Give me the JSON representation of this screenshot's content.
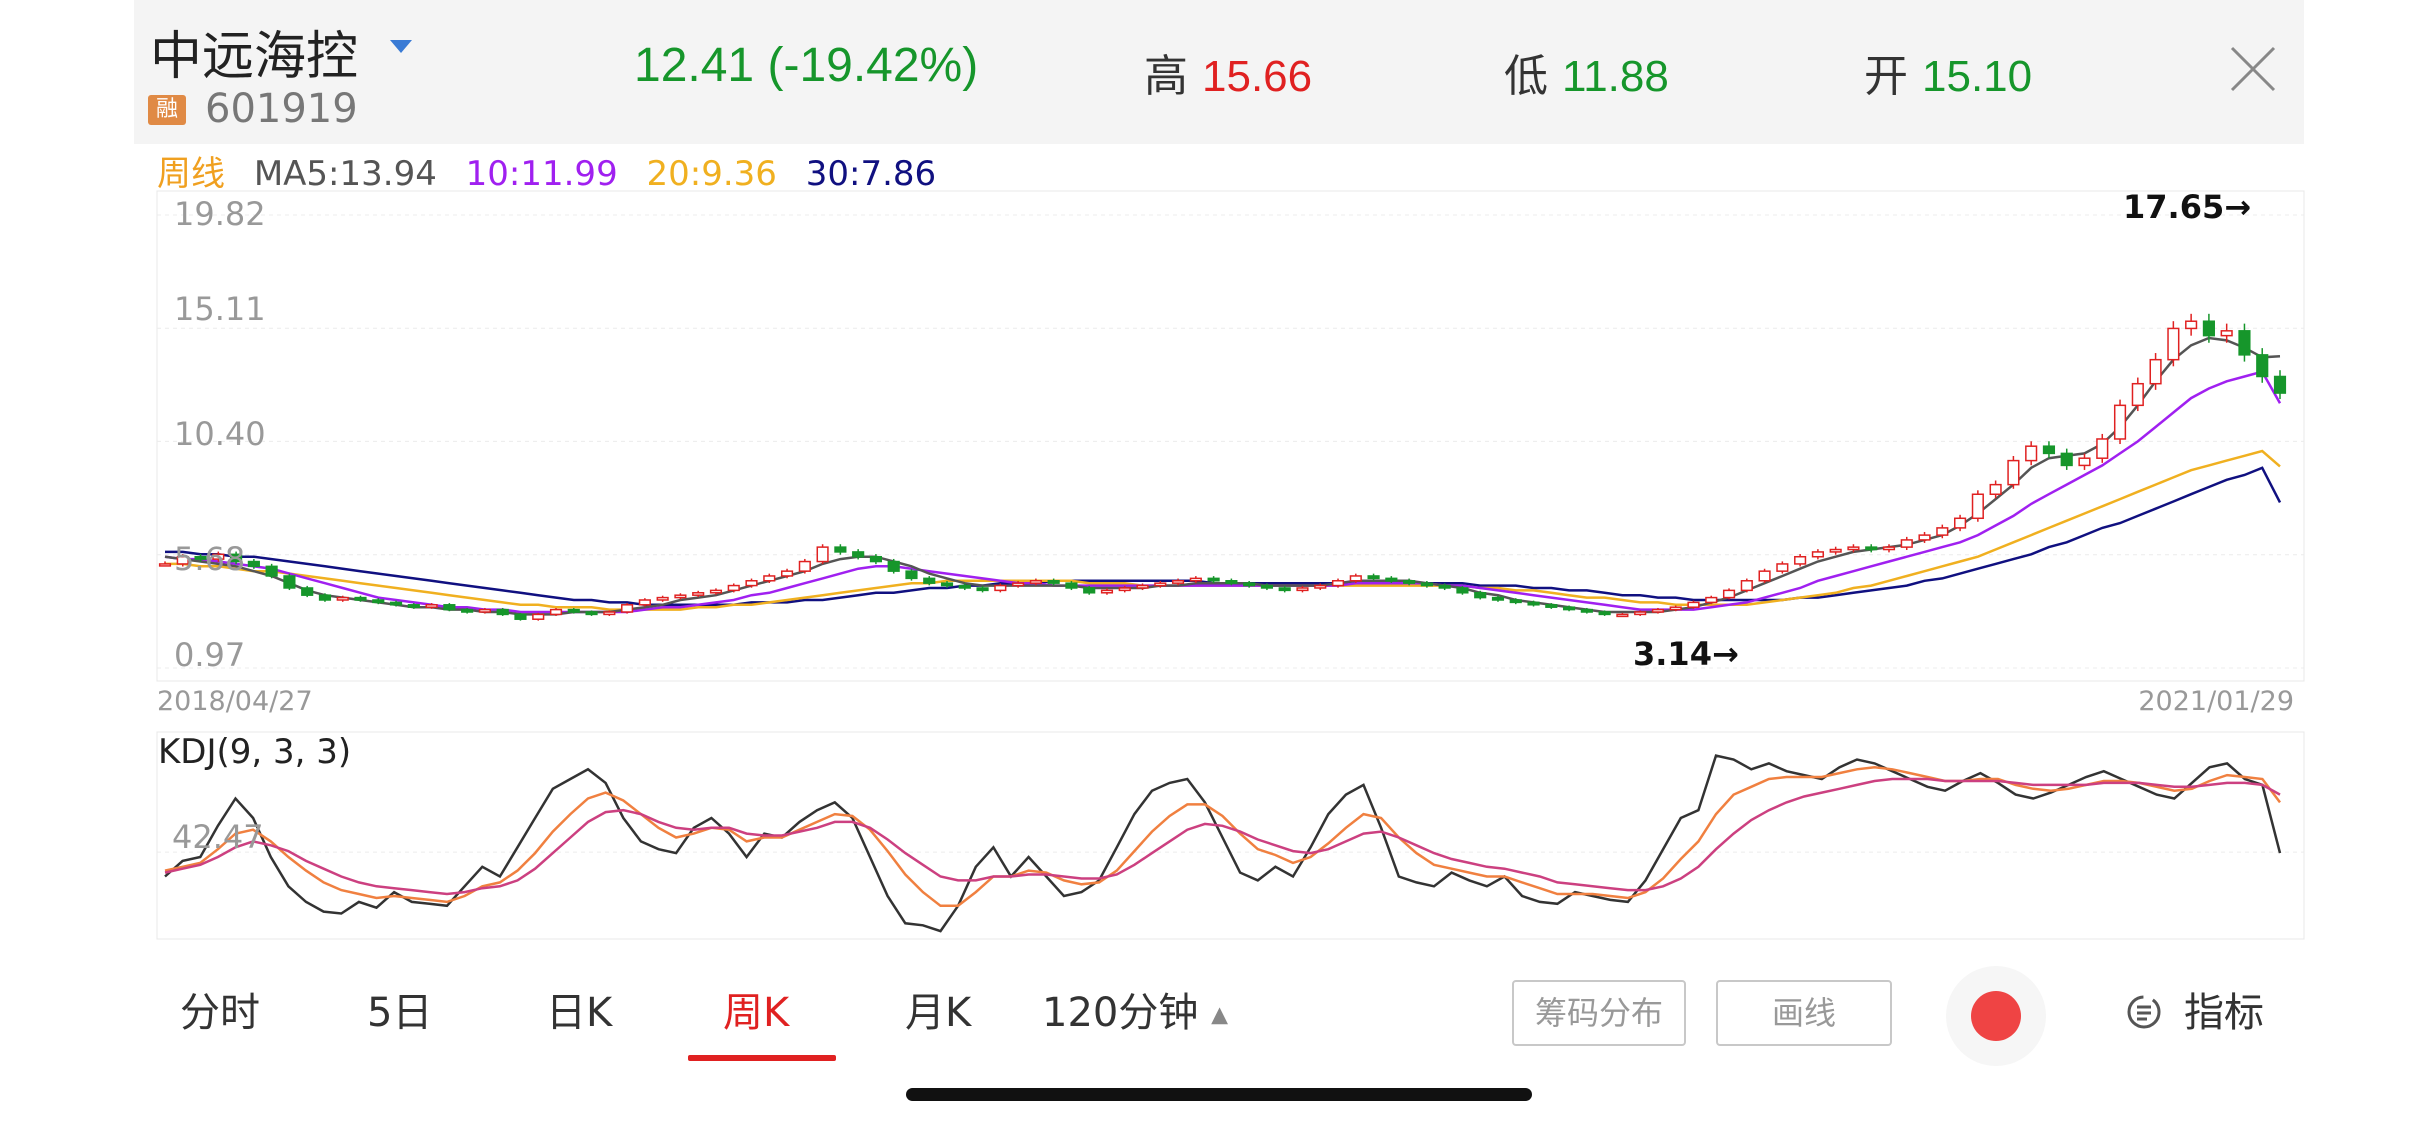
{
  "header": {
    "stock_name": "中远海控",
    "margin_badge": "融",
    "stock_code": "601919",
    "price": "12.41",
    "change_pct": "(-19.42%)",
    "high_label": "高",
    "high_value": "15.66",
    "low_label": "低",
    "low_value": "11.88",
    "open_label": "开",
    "open_value": "15.10"
  },
  "ma_legend": {
    "period": "周线",
    "ma5": "MA5:13.94",
    "ma10": "10:11.99",
    "ma20": "20:9.36",
    "ma30": "30:7.86"
  },
  "colors": {
    "up": "#e02121",
    "down": "#16962b",
    "ma5": "#555555",
    "ma10": "#a020f0",
    "ma20": "#f0b020",
    "ma30": "#101080",
    "k": "#333333",
    "d": "#f08040",
    "j": "#cc4080"
  },
  "chart_data": [
    {
      "type": "candlestick",
      "title": "周线",
      "y_ticks": [
        "19.82",
        "15.11",
        "10.40",
        "5.68",
        "0.97"
      ],
      "ylim": [
        0.97,
        19.82
      ],
      "x_start_label": "2018/04/27",
      "x_end_label": "2021/01/29",
      "annotations": [
        {
          "text": "17.65→",
          "value": 17.65
        },
        {
          "text": "3.14→",
          "value": 3.14
        }
      ],
      "close": [
        5.3,
        5.6,
        5.5,
        5.7,
        5.4,
        5.2,
        4.8,
        4.3,
        4.0,
        3.8,
        3.9,
        3.8,
        3.7,
        3.6,
        3.5,
        3.6,
        3.4,
        3.3,
        3.4,
        3.2,
        3.0,
        3.2,
        3.4,
        3.3,
        3.2,
        3.3,
        3.6,
        3.8,
        3.9,
        4.0,
        4.1,
        4.2,
        4.4,
        4.6,
        4.8,
        5.0,
        5.4,
        6.0,
        5.8,
        5.6,
        5.4,
        5.0,
        4.7,
        4.5,
        4.4,
        4.3,
        4.2,
        4.4,
        4.5,
        4.6,
        4.5,
        4.3,
        4.1,
        4.2,
        4.3,
        4.4,
        4.5,
        4.6,
        4.7,
        4.6,
        4.5,
        4.4,
        4.3,
        4.2,
        4.3,
        4.4,
        4.6,
        4.8,
        4.7,
        4.6,
        4.5,
        4.4,
        4.3,
        4.1,
        3.9,
        3.8,
        3.7,
        3.6,
        3.5,
        3.4,
        3.3,
        3.2,
        3.2,
        3.3,
        3.4,
        3.5,
        3.7,
        3.9,
        4.2,
        4.6,
        5.0,
        5.3,
        5.6,
        5.8,
        5.9,
        6.0,
        5.9,
        6.0,
        6.3,
        6.5,
        6.8,
        7.2,
        8.2,
        8.6,
        9.6,
        10.2,
        9.9,
        9.4,
        9.7,
        10.5,
        11.9,
        12.8,
        13.8,
        15.1,
        15.4,
        14.8,
        15.0,
        14.0,
        13.1,
        12.41
      ],
      "ma": {
        "ma5": [
          5.6,
          5.5,
          5.4,
          5.3,
          5.2,
          5.0,
          4.8,
          4.5,
          4.2,
          4.0,
          3.9,
          3.8,
          3.7,
          3.6,
          3.5,
          3.5,
          3.4,
          3.4,
          3.3,
          3.3,
          3.2,
          3.2,
          3.2,
          3.3,
          3.3,
          3.3,
          3.4,
          3.5,
          3.6,
          3.8,
          3.9,
          4.0,
          4.2,
          4.4,
          4.6,
          4.8,
          5.0,
          5.3,
          5.5,
          5.6,
          5.6,
          5.4,
          5.2,
          4.9,
          4.7,
          4.5,
          4.4,
          4.4,
          4.4,
          4.4,
          4.4,
          4.4,
          4.3,
          4.3,
          4.3,
          4.3,
          4.4,
          4.4,
          4.5,
          4.5,
          4.5,
          4.5,
          4.4,
          4.4,
          4.4,
          4.4,
          4.5,
          4.6,
          4.6,
          4.6,
          4.6,
          4.5,
          4.4,
          4.3,
          4.1,
          4.0,
          3.8,
          3.7,
          3.6,
          3.5,
          3.4,
          3.3,
          3.3,
          3.3,
          3.3,
          3.4,
          3.5,
          3.7,
          3.9,
          4.2,
          4.5,
          4.8,
          5.1,
          5.4,
          5.6,
          5.8,
          5.9,
          6.0,
          6.1,
          6.3,
          6.5,
          6.9,
          7.4,
          8.0,
          8.6,
          9.3,
          9.7,
          9.8,
          9.9,
          10.3,
          11.0,
          11.9,
          12.9,
          13.8,
          14.4,
          14.7,
          14.6,
          14.3,
          13.9,
          13.94
        ],
        "ma10": [
          5.6,
          5.5,
          5.5,
          5.4,
          5.3,
          5.2,
          5.1,
          4.9,
          4.7,
          4.5,
          4.3,
          4.1,
          3.9,
          3.8,
          3.7,
          3.6,
          3.5,
          3.5,
          3.4,
          3.4,
          3.3,
          3.3,
          3.3,
          3.3,
          3.3,
          3.3,
          3.3,
          3.4,
          3.5,
          3.5,
          3.6,
          3.7,
          3.8,
          4.0,
          4.1,
          4.3,
          4.5,
          4.7,
          4.9,
          5.1,
          5.2,
          5.2,
          5.1,
          5.0,
          4.9,
          4.8,
          4.7,
          4.6,
          4.5,
          4.5,
          4.4,
          4.4,
          4.4,
          4.4,
          4.4,
          4.4,
          4.4,
          4.4,
          4.4,
          4.4,
          4.4,
          4.4,
          4.4,
          4.4,
          4.4,
          4.4,
          4.4,
          4.5,
          4.5,
          4.5,
          4.5,
          4.5,
          4.4,
          4.4,
          4.3,
          4.2,
          4.1,
          4.0,
          3.9,
          3.8,
          3.7,
          3.6,
          3.5,
          3.4,
          3.4,
          3.4,
          3.4,
          3.5,
          3.6,
          3.7,
          3.9,
          4.1,
          4.3,
          4.6,
          4.8,
          5.0,
          5.2,
          5.4,
          5.6,
          5.8,
          6.0,
          6.2,
          6.5,
          6.9,
          7.3,
          7.8,
          8.2,
          8.6,
          9.0,
          9.4,
          9.9,
          10.4,
          11.0,
          11.6,
          12.2,
          12.6,
          12.9,
          13.1,
          13.3,
          11.99
        ],
        "ma20": [
          5.3,
          5.3,
          5.2,
          5.2,
          5.1,
          5.0,
          5.0,
          4.9,
          4.8,
          4.7,
          4.6,
          4.5,
          4.4,
          4.3,
          4.2,
          4.1,
          4.0,
          3.9,
          3.8,
          3.7,
          3.6,
          3.6,
          3.5,
          3.5,
          3.5,
          3.4,
          3.4,
          3.4,
          3.4,
          3.4,
          3.5,
          3.5,
          3.6,
          3.6,
          3.7,
          3.8,
          3.9,
          4.0,
          4.1,
          4.2,
          4.3,
          4.4,
          4.5,
          4.5,
          4.6,
          4.6,
          4.6,
          4.6,
          4.6,
          4.6,
          4.6,
          4.6,
          4.5,
          4.5,
          4.5,
          4.4,
          4.4,
          4.4,
          4.4,
          4.4,
          4.4,
          4.4,
          4.4,
          4.4,
          4.4,
          4.4,
          4.4,
          4.4,
          4.4,
          4.4,
          4.4,
          4.4,
          4.4,
          4.4,
          4.3,
          4.3,
          4.2,
          4.2,
          4.1,
          4.0,
          3.9,
          3.9,
          3.8,
          3.7,
          3.7,
          3.6,
          3.6,
          3.6,
          3.6,
          3.6,
          3.7,
          3.8,
          3.9,
          4.0,
          4.1,
          4.3,
          4.4,
          4.6,
          4.8,
          5.0,
          5.2,
          5.4,
          5.6,
          5.9,
          6.2,
          6.5,
          6.8,
          7.1,
          7.4,
          7.7,
          8.0,
          8.3,
          8.6,
          8.9,
          9.2,
          9.4,
          9.6,
          9.8,
          10.0,
          9.36
        ],
        "ma30": [
          5.8,
          5.8,
          5.7,
          5.7,
          5.6,
          5.6,
          5.5,
          5.4,
          5.3,
          5.2,
          5.1,
          5.0,
          4.9,
          4.8,
          4.7,
          4.6,
          4.5,
          4.4,
          4.3,
          4.2,
          4.1,
          4.0,
          3.9,
          3.8,
          3.8,
          3.7,
          3.7,
          3.6,
          3.6,
          3.6,
          3.6,
          3.6,
          3.6,
          3.7,
          3.7,
          3.7,
          3.8,
          3.8,
          3.9,
          4.0,
          4.1,
          4.1,
          4.2,
          4.3,
          4.3,
          4.4,
          4.4,
          4.5,
          4.5,
          4.5,
          4.6,
          4.6,
          4.6,
          4.6,
          4.6,
          4.6,
          4.6,
          4.6,
          4.6,
          4.5,
          4.5,
          4.5,
          4.5,
          4.5,
          4.5,
          4.5,
          4.5,
          4.5,
          4.5,
          4.5,
          4.5,
          4.5,
          4.5,
          4.5,
          4.4,
          4.4,
          4.4,
          4.3,
          4.3,
          4.2,
          4.2,
          4.1,
          4.0,
          4.0,
          3.9,
          3.9,
          3.8,
          3.8,
          3.8,
          3.8,
          3.8,
          3.8,
          3.9,
          3.9,
          4.0,
          4.1,
          4.2,
          4.3,
          4.4,
          4.6,
          4.7,
          4.9,
          5.1,
          5.3,
          5.5,
          5.7,
          6.0,
          6.2,
          6.5,
          6.8,
          7.0,
          7.3,
          7.6,
          7.9,
          8.2,
          8.5,
          8.8,
          9.0,
          9.3,
          7.86
        ]
      }
    },
    {
      "type": "line",
      "title": "KDJ(9, 3, 3)",
      "y_tick": "42.47",
      "ylim": [
        0,
        100
      ],
      "series": [
        {
          "name": "K",
          "values": [
            30,
            38,
            40,
            56,
            70,
            60,
            40,
            25,
            17,
            12,
            11,
            17,
            14,
            22,
            17,
            16,
            15,
            25,
            35,
            30,
            45,
            60,
            75,
            80,
            85,
            78,
            60,
            48,
            44,
            42,
            55,
            60,
            52,
            40,
            52,
            50,
            58,
            64,
            68,
            60,
            40,
            20,
            6,
            5,
            2,
            15,
            35,
            45,
            30,
            40,
            30,
            20,
            22,
            28,
            45,
            62,
            74,
            78,
            80,
            68,
            50,
            32,
            28,
            35,
            30,
            45,
            62,
            72,
            77,
            55,
            30,
            27,
            25,
            32,
            28,
            25,
            30,
            20,
            17,
            16,
            22,
            20,
            18,
            17,
            28,
            44,
            60,
            64,
            92,
            90,
            85,
            88,
            84,
            82,
            80,
            86,
            90,
            88,
            84,
            80,
            76,
            74,
            79,
            83,
            78,
            72,
            70,
            73,
            77,
            81,
            84,
            80,
            76,
            72,
            70,
            78,
            86,
            88,
            80,
            77,
            42
          ]
        },
        {
          "name": "D",
          "values": [
            33,
            35,
            37,
            44,
            52,
            54,
            48,
            40,
            33,
            27,
            23,
            21,
            19,
            20,
            19,
            18,
            17,
            20,
            25,
            27,
            33,
            42,
            53,
            62,
            70,
            73,
            69,
            62,
            55,
            50,
            52,
            55,
            54,
            48,
            50,
            50,
            54,
            58,
            62,
            61,
            54,
            43,
            31,
            22,
            15,
            15,
            22,
            30,
            30,
            33,
            32,
            28,
            26,
            27,
            33,
            43,
            53,
            61,
            67,
            67,
            61,
            52,
            44,
            41,
            37,
            40,
            47,
            55,
            62,
            60,
            50,
            42,
            36,
            34,
            32,
            30,
            30,
            27,
            24,
            21,
            21,
            21,
            20,
            19,
            22,
            29,
            39,
            48,
            62,
            72,
            76,
            80,
            81,
            81,
            81,
            83,
            85,
            86,
            85,
            83,
            81,
            79,
            79,
            80,
            80,
            77,
            75,
            74,
            75,
            77,
            79,
            79,
            78,
            76,
            74,
            75,
            79,
            82,
            81,
            80,
            68
          ]
        },
        {
          "name": "J",
          "values": [
            32,
            34,
            36,
            40,
            45,
            48,
            46,
            43,
            38,
            34,
            30,
            27,
            25,
            24,
            23,
            22,
            21,
            22,
            24,
            25,
            28,
            34,
            42,
            50,
            58,
            63,
            64,
            62,
            58,
            55,
            54,
            55,
            55,
            52,
            51,
            51,
            53,
            55,
            58,
            58,
            55,
            49,
            42,
            36,
            30,
            28,
            28,
            30,
            30,
            31,
            31,
            30,
            29,
            29,
            31,
            36,
            42,
            48,
            54,
            57,
            56,
            53,
            49,
            46,
            43,
            42,
            44,
            48,
            52,
            53,
            50,
            46,
            42,
            39,
            37,
            35,
            34,
            32,
            30,
            27,
            26,
            25,
            24,
            23,
            23,
            25,
            29,
            35,
            44,
            52,
            59,
            64,
            68,
            71,
            73,
            75,
            77,
            79,
            80,
            80,
            80,
            79,
            79,
            79,
            79,
            78,
            77,
            77,
            77,
            77,
            78,
            78,
            78,
            77,
            76,
            76,
            77,
            78,
            78,
            77,
            72
          ]
        }
      ]
    }
  ],
  "tabs": [
    "分时",
    "5日",
    "日K",
    "周K",
    "月K",
    "120分钟"
  ],
  "active_tab": "周K",
  "tools": {
    "chips_label": "筹码分布",
    "draw_label": "画线",
    "indicator_label": "指标"
  }
}
